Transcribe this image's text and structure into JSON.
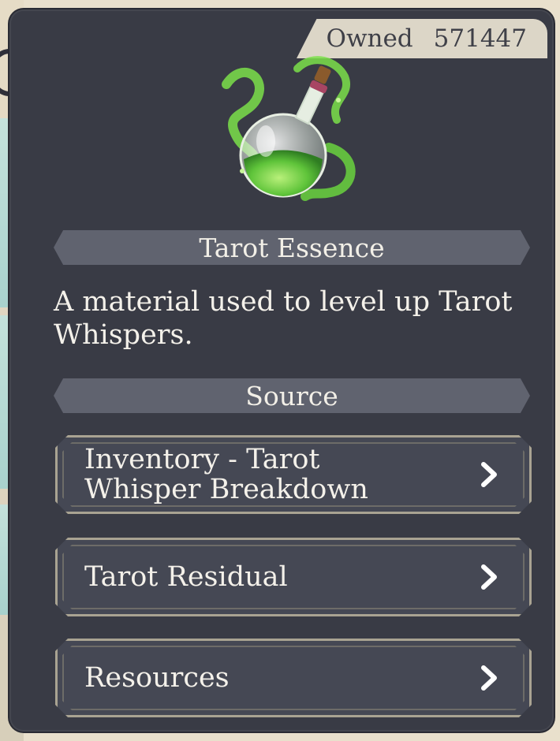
{
  "owned": {
    "label": "Owned",
    "count": "571447"
  },
  "item": {
    "icon": "green-potion-icon",
    "name": "Tarot Essence",
    "description": "A material used to level up Tarot Whispers."
  },
  "source": {
    "header": "Source",
    "entries": [
      {
        "label": "Inventory - Tarot Whisper Breakdown"
      },
      {
        "label": "Tarot Residual"
      },
      {
        "label": "Resources"
      }
    ]
  },
  "colors": {
    "panel": "#393b45",
    "bar": "#60636f",
    "tab": "#dcd6c7",
    "potion": "#6fd34a"
  }
}
